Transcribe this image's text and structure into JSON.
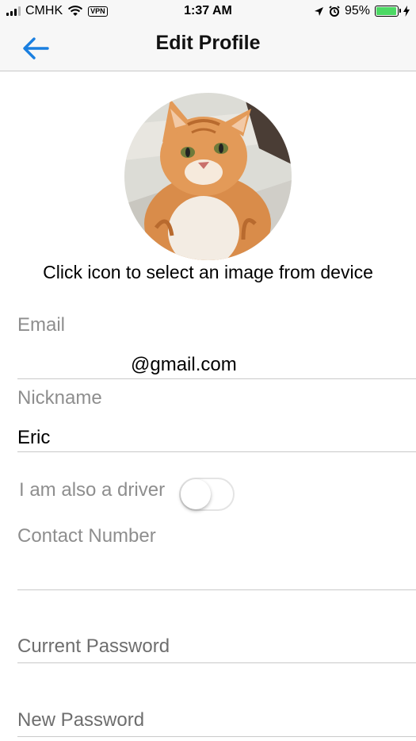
{
  "status_bar": {
    "carrier": "CMHK",
    "vpn": "VPN",
    "time": "1:37 AM",
    "battery": "95%",
    "battery_level": 0.95,
    "battery_color": "#4cd964"
  },
  "nav": {
    "title": "Edit Profile",
    "back_icon": "back-arrow-icon",
    "accent_color": "#1a7fe0"
  },
  "avatar": {
    "hint": "Click icon to select an image from device"
  },
  "form": {
    "email": {
      "label": "Email",
      "value": "@gmail.com"
    },
    "nickname": {
      "label": "Nickname",
      "value": "Eric"
    },
    "driver": {
      "label": "I am also a driver",
      "on": false
    },
    "contact": {
      "label": "Contact Number",
      "value": ""
    },
    "current_password": {
      "placeholder": "Current Password"
    },
    "new_password": {
      "placeholder": "New Password"
    }
  }
}
